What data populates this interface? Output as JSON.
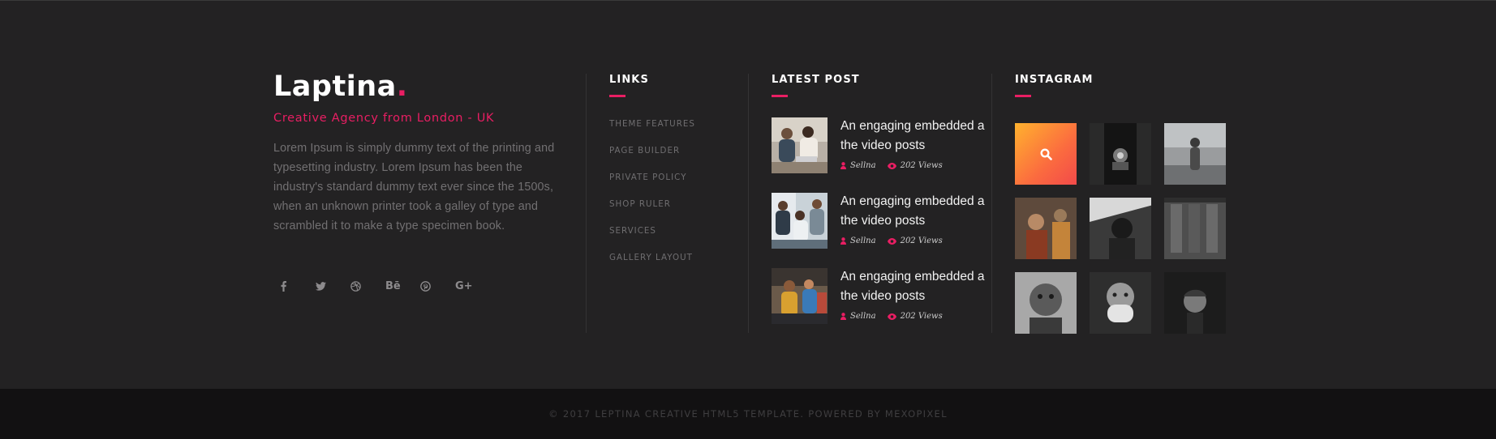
{
  "brand": {
    "logo": "Laptina",
    "logo_dot": ".",
    "tagline": "Creative Agency from London - UK",
    "about": "Lorem Ipsum is simply dummy text of the printing and typesetting industry. Lorem Ipsum has been the industry's standard dummy text ever since the 1500s, when an unknown printer took a galley of type and scrambled it to make a type specimen book.",
    "social": [
      {
        "name": "facebook-icon",
        "glyph": "f"
      },
      {
        "name": "twitter-icon",
        "glyph": ""
      },
      {
        "name": "dribbble-icon",
        "glyph": ""
      },
      {
        "name": "behance-icon",
        "glyph": "Bē"
      },
      {
        "name": "pinterest-icon",
        "glyph": ""
      },
      {
        "name": "google-plus-icon",
        "glyph": "G+"
      }
    ]
  },
  "links": {
    "title": "LINKS",
    "items": [
      "THEME FEATURES",
      "PAGE BUILDER",
      "PRIVATE POLICY",
      "SHOP RULER",
      "SERVICES",
      "GALLERY LAYOUT"
    ]
  },
  "latest_post": {
    "title": "LATEST POST",
    "posts": [
      {
        "title": "An engaging embedded a the video posts",
        "author": "Sellna",
        "views": "202 Views"
      },
      {
        "title": "An engaging embedded a the video posts",
        "author": "Sellna",
        "views": "202 Views"
      },
      {
        "title": "An engaging embedded a the video posts",
        "author": "Sellna",
        "views": "202 Views"
      }
    ]
  },
  "instagram": {
    "title": "INSTAGRAM",
    "search_icon": "search-icon",
    "tiles": [
      "search",
      "photo",
      "photo",
      "photo",
      "photo",
      "photo",
      "photo",
      "photo",
      "photo"
    ]
  },
  "footer": {
    "copyright": "© 2017 LEPTINA CREATIVE HTML5 TEMPLATE. POWERED BY MEXOPIXEL"
  },
  "colors": {
    "accent": "#e91e63",
    "background": "#232223",
    "bottom_bar": "#121112"
  }
}
